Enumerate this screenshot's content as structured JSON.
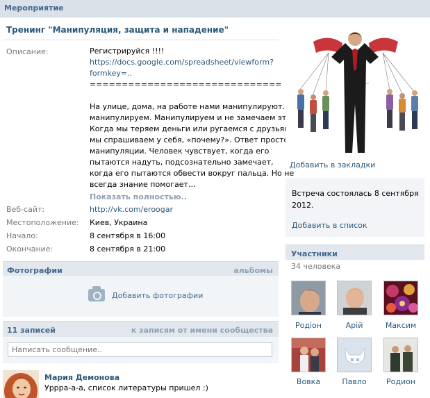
{
  "section_title": "Мероприятие",
  "event": {
    "title": "Тренинг \"Манипуляция, защита и нападение\"",
    "description_label": "Описание:",
    "description_lines": [
      "Регистрируйся !!!!",
      "https://docs.google.com/spreadsheet/viewform?",
      "formkey=..",
      "==============================",
      "",
      "На улице, дома, на работе нами манипулируют. Мы",
      "манипулируем. Манипулируем и не замечаем этого.",
      "Когда мы теряем деньги или ругаемся с друзьями,",
      "мы спрашиваем у себя, «почему?». Ответ простой –",
      "манипуляции. Человек чувствует, когда его",
      "пытаются надуть, подсознательно замечает,",
      "когда его пытаются обвести вокруг пальца. Но не",
      "всегда знание помогает..."
    ],
    "show_more": "Показать полностью..",
    "website_label": "Веб-сайт:",
    "website": "http://vk.com/eroogar",
    "location_label": "Местоположение:",
    "location": "Киев, Украина",
    "start_label": "Начало:",
    "start": "8 сентября в 16:00",
    "end_label": "Окончание:",
    "end": "8 сентября в 21:00"
  },
  "photos": {
    "header": "Фотографии",
    "albums_link": "альбомы",
    "add_photos": "Добавить фотографии"
  },
  "wall": {
    "count": "11 записей",
    "community_link": "к записям от имени сообщества",
    "placeholder": "Написать сообщение..",
    "post": {
      "author": "Мария Демонова",
      "text": "Урррa-a-a, список литературы пришел :)"
    }
  },
  "sidebar": {
    "bookmark": "Добавить в закладки",
    "status_lines": [
      "Встреча состоялась 8 сентября",
      "2012."
    ],
    "add_to_list": "Добавить в список",
    "members_header": "Участники",
    "members_count": "34 человека",
    "members": [
      {
        "name": "Родіон"
      },
      {
        "name": "Арій"
      },
      {
        "name": "Максим"
      },
      {
        "name": "Вовка"
      },
      {
        "name": "Павло"
      },
      {
        "name": "Родион"
      }
    ]
  },
  "colors": {
    "link": "#2b587a",
    "header_text": "#45688e",
    "header_bg": "#e1e7ed",
    "muted": "#8fa1b3"
  }
}
